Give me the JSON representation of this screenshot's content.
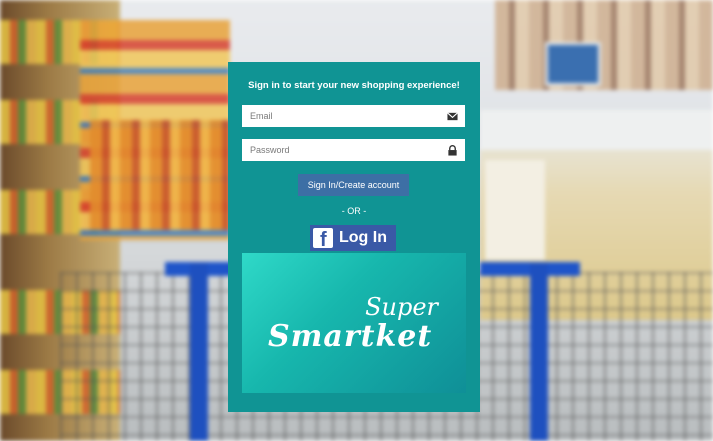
{
  "login": {
    "heading": "Sign in to start your new shopping experience!",
    "email_placeholder": "Email",
    "password_placeholder": "Password",
    "signin_label": "Sign In/Create account",
    "separator": "- OR -",
    "facebook": {
      "icon_letter": "f",
      "label": "Log In"
    }
  },
  "brand": {
    "word1": "Super",
    "word2": "Smartket"
  },
  "colors": {
    "card": "#109494",
    "signin_button": "#3d6fa5",
    "facebook_button": "#3a59a6",
    "cart": "#1f55c9",
    "logo_gradient": [
      "#2fd9c8",
      "#0f8f97"
    ]
  },
  "icons": {
    "email": "envelope-icon",
    "password": "lock-icon",
    "facebook": "facebook-icon"
  }
}
